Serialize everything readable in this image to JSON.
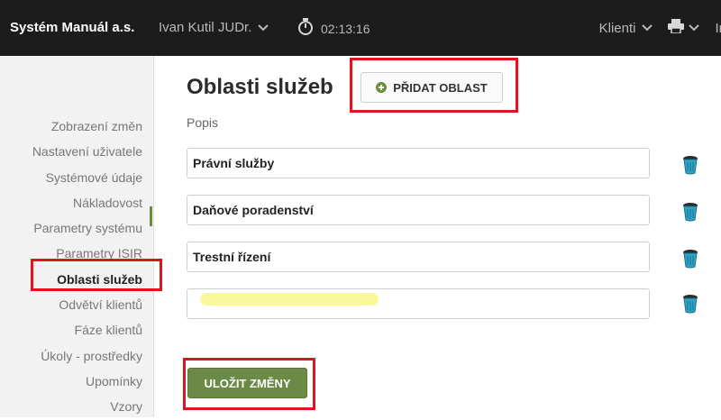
{
  "topbar": {
    "brand": "Systém Manuál a.s.",
    "user": "Ivan Kutil JUDr.",
    "timer": "02:13:16",
    "clients": "Klienti",
    "truncated": "In"
  },
  "sidebar": {
    "items": [
      {
        "label": "Zobrazení změn"
      },
      {
        "label": "Nastavení uživatele"
      },
      {
        "label": "Systémové údaje"
      },
      {
        "label": "Nákladovost"
      },
      {
        "label": "Parametry systému"
      },
      {
        "label": "Parametry ISIR"
      },
      {
        "label": "Oblasti služeb"
      },
      {
        "label": "Odvětví klientů"
      },
      {
        "label": "Fáze klientů"
      },
      {
        "label": "Úkoly - prostředky"
      },
      {
        "label": "Upomínky"
      },
      {
        "label": "Vzory"
      }
    ],
    "active_index": 6
  },
  "main": {
    "title": "Oblasti služeb",
    "add_button": "PŘIDAT OBLAST",
    "column_label": "Popis",
    "fields": [
      {
        "value": "Právní služby"
      },
      {
        "value": "Daňové poradenství"
      },
      {
        "value": "Trestní řízení"
      },
      {
        "value": ""
      }
    ],
    "save_button": "ULOŽIT ZMĚNY"
  },
  "colors": {
    "accent": "#6a8a45",
    "topbar_bg": "#1c1c1c",
    "annotation_red": "#e0141f",
    "highlight_yellow": "#f4f24a"
  },
  "icons": [
    "chevron-down-icon",
    "stopwatch-icon",
    "printer-icon",
    "plus-circle-icon",
    "trash-icon"
  ]
}
